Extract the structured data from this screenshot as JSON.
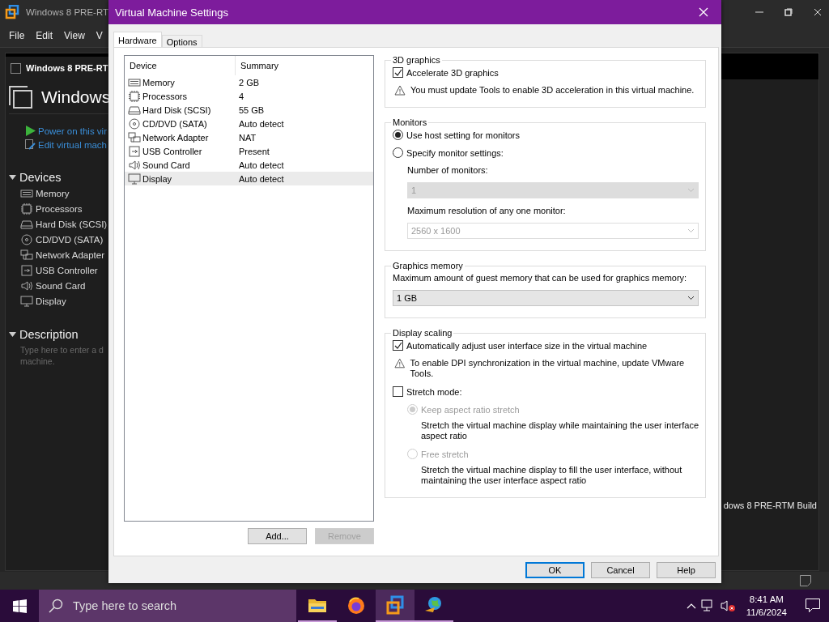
{
  "app_window": {
    "title": "Windows 8 PRE-RT",
    "menu": [
      "File",
      "Edit",
      "View",
      "V"
    ],
    "tab": "Windows 8 PRE-RT",
    "heading": "Windows",
    "actions": [
      {
        "label": "Power on this vir",
        "kind": "power"
      },
      {
        "label": "Edit virtual mach",
        "kind": "edit"
      }
    ],
    "devices_heading": "Devices",
    "devices": [
      {
        "label": "Memory",
        "kind": "memory"
      },
      {
        "label": "Processors",
        "kind": "cpu"
      },
      {
        "label": "Hard Disk (SCSI)",
        "kind": "disk"
      },
      {
        "label": "CD/DVD (SATA)",
        "kind": "cd"
      },
      {
        "label": "Network Adapter",
        "kind": "network"
      },
      {
        "label": "USB Controller",
        "kind": "usb"
      },
      {
        "label": "Sound Card",
        "kind": "sound"
      },
      {
        "label": "Display",
        "kind": "display"
      }
    ],
    "description_heading": "Description",
    "description_lines": [
      "Type here to enter a d",
      "machine."
    ],
    "vm_label": "dows 8 PRE-RTM Build"
  },
  "dialog": {
    "title": "Virtual Machine Settings",
    "tabs": [
      {
        "label": "Hardware",
        "selected": true
      },
      {
        "label": "Options",
        "selected": false
      }
    ],
    "columns": [
      "Device",
      "Summary"
    ],
    "rows": [
      {
        "device": "Memory",
        "summary": "2 GB",
        "kind": "memory",
        "selected": false
      },
      {
        "device": "Processors",
        "summary": "4",
        "kind": "cpu",
        "selected": false
      },
      {
        "device": "Hard Disk (SCSI)",
        "summary": "55 GB",
        "kind": "disk",
        "selected": false
      },
      {
        "device": "CD/DVD (SATA)",
        "summary": "Auto detect",
        "kind": "cd",
        "selected": false
      },
      {
        "device": "Network Adapter",
        "summary": "NAT",
        "kind": "network",
        "selected": false
      },
      {
        "device": "USB Controller",
        "summary": "Present",
        "kind": "usb",
        "selected": false
      },
      {
        "device": "Sound Card",
        "summary": "Auto detect",
        "kind": "sound",
        "selected": false
      },
      {
        "device": "Display",
        "summary": "Auto detect",
        "kind": "display",
        "selected": true
      }
    ],
    "list_buttons": [
      {
        "label": "Add...",
        "disabled": false
      },
      {
        "label": "Remove",
        "disabled": true
      }
    ],
    "groups": [
      {
        "title": "3D graphics",
        "items": [
          {
            "kind": "checkbox",
            "label": "Accelerate 3D graphics",
            "checked": true,
            "disabled": false
          },
          {
            "kind": "warning",
            "text": "You must update Tools to enable 3D acceleration in this virtual machine."
          }
        ]
      },
      {
        "title": "Monitors",
        "items": [
          {
            "kind": "radio",
            "label": "Use host setting for monitors",
            "selected": true,
            "disabled": false
          },
          {
            "kind": "radio",
            "label": "Specify monitor settings:",
            "selected": false,
            "disabled": false,
            "children": [
              {
                "kind": "label",
                "text": "Number of monitors:"
              },
              {
                "kind": "select",
                "value": "1",
                "disabled": true
              },
              {
                "kind": "label",
                "text": "Maximum resolution of any one monitor:"
              },
              {
                "kind": "select",
                "value": "2560 x 1600",
                "disabled": true
              }
            ]
          }
        ]
      },
      {
        "title": "Graphics memory",
        "items": [
          {
            "kind": "label",
            "text": "Maximum amount of guest memory that can be used for graphics memory:"
          },
          {
            "kind": "select",
            "value": "1 GB",
            "disabled": false
          }
        ]
      },
      {
        "title": "Display scaling",
        "items": [
          {
            "kind": "checkbox",
            "label": "Automatically adjust user interface size in the virtual machine",
            "checked": true,
            "disabled": false
          },
          {
            "kind": "warning",
            "text": "To enable DPI synchronization in the virtual machine, update VMware Tools."
          },
          {
            "kind": "checkbox",
            "label": "Stretch mode:",
            "checked": false,
            "disabled": false,
            "children": [
              {
                "kind": "radio",
                "label": "Keep aspect ratio stretch",
                "selected": true,
                "disabled": true
              },
              {
                "kind": "description",
                "text": "Stretch the virtual machine display while maintaining the user interface aspect ratio"
              },
              {
                "kind": "radio",
                "label": "Free stretch",
                "selected": false,
                "disabled": true
              },
              {
                "kind": "description",
                "text": "Stretch the virtual machine display to fill the user interface, without maintaining the user interface aspect ratio"
              }
            ]
          }
        ]
      }
    ],
    "buttons": [
      {
        "label": "OK",
        "default": true
      },
      {
        "label": "Cancel",
        "default": false
      },
      {
        "label": "Help",
        "default": false
      }
    ]
  },
  "taskbar": {
    "search_placeholder": "Type here to search",
    "apps": [
      {
        "kind": "folder",
        "running": true,
        "selected": false
      },
      {
        "kind": "browser",
        "running": false,
        "selected": false
      },
      {
        "kind": "vm",
        "running": true,
        "selected": true
      },
      {
        "kind": "globe",
        "running": true,
        "selected": false
      }
    ],
    "time": "8:41 AM",
    "date": "11/6/2024"
  }
}
